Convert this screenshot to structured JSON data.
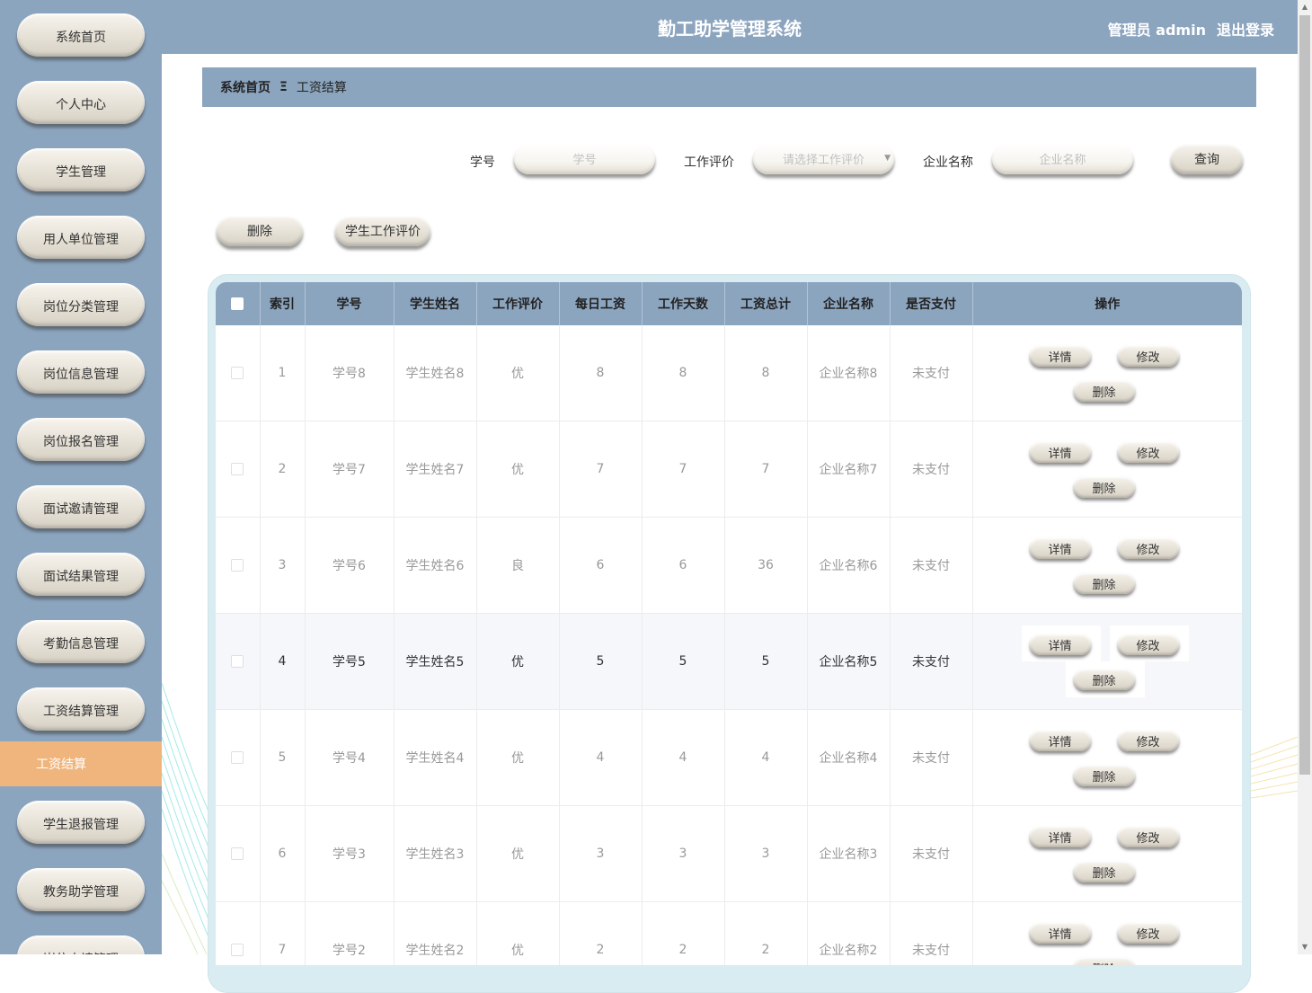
{
  "header": {
    "title": "勤工助学管理系统",
    "user_role": "管理员 admin",
    "logout": "退出登录"
  },
  "sidebar": {
    "items": [
      {
        "label": "系统首页"
      },
      {
        "label": "个人中心"
      },
      {
        "label": "学生管理"
      },
      {
        "label": "用人单位管理"
      },
      {
        "label": "岗位分类管理"
      },
      {
        "label": "岗位信息管理"
      },
      {
        "label": "岗位报名管理"
      },
      {
        "label": "面试邀请管理"
      },
      {
        "label": "面试结果管理"
      },
      {
        "label": "考勤信息管理"
      },
      {
        "label": "工资结算管理"
      },
      {
        "label": "工资结算",
        "active": true
      },
      {
        "label": "学生退报管理"
      },
      {
        "label": "教务助学管理"
      },
      {
        "label": "岗位申请管理"
      }
    ]
  },
  "breadcrumb": {
    "home": "系统首页",
    "separator": "Ξ",
    "current": "工资结算"
  },
  "search": {
    "student_no_label": "学号",
    "student_no_placeholder": "学号",
    "rating_label": "工作评价",
    "rating_placeholder": "请选择工作评价",
    "company_label": "企业名称",
    "company_placeholder": "企业名称",
    "query_button": "查询"
  },
  "actions": {
    "delete": "删除",
    "evaluate": "学生工作评价"
  },
  "table": {
    "columns": [
      "索引",
      "学号",
      "学生姓名",
      "工作评价",
      "每日工资",
      "工作天数",
      "工资总计",
      "企业名称",
      "是否支付",
      "操作"
    ],
    "rows": [
      {
        "index": "1",
        "student_no": "学号8",
        "name": "学生姓名8",
        "rating": "优",
        "daily_wage": "8",
        "days": "8",
        "total": "8",
        "company": "企业名称8",
        "paid": "未支付"
      },
      {
        "index": "2",
        "student_no": "学号7",
        "name": "学生姓名7",
        "rating": "优",
        "daily_wage": "7",
        "days": "7",
        "total": "7",
        "company": "企业名称7",
        "paid": "未支付"
      },
      {
        "index": "3",
        "student_no": "学号6",
        "name": "学生姓名6",
        "rating": "良",
        "daily_wage": "6",
        "days": "6",
        "total": "36",
        "company": "企业名称6",
        "paid": "未支付"
      },
      {
        "index": "4",
        "student_no": "学号5",
        "name": "学生姓名5",
        "rating": "优",
        "daily_wage": "5",
        "days": "5",
        "total": "5",
        "company": "企业名称5",
        "paid": "未支付"
      },
      {
        "index": "5",
        "student_no": "学号4",
        "name": "学生姓名4",
        "rating": "优",
        "daily_wage": "4",
        "days": "4",
        "total": "4",
        "company": "企业名称4",
        "paid": "未支付"
      },
      {
        "index": "6",
        "student_no": "学号3",
        "name": "学生姓名3",
        "rating": "优",
        "daily_wage": "3",
        "days": "3",
        "total": "3",
        "company": "企业名称3",
        "paid": "未支付"
      },
      {
        "index": "7",
        "student_no": "学号2",
        "name": "学生姓名2",
        "rating": "优",
        "daily_wage": "2",
        "days": "2",
        "total": "2",
        "company": "企业名称2",
        "paid": "未支付"
      }
    ],
    "op_detail": "详情",
    "op_edit": "修改",
    "op_delete": "删除"
  },
  "colors": {
    "primary": "#8ca5bf",
    "active_menu": "#f0b57d",
    "table_frame": "#d9ecf1"
  }
}
